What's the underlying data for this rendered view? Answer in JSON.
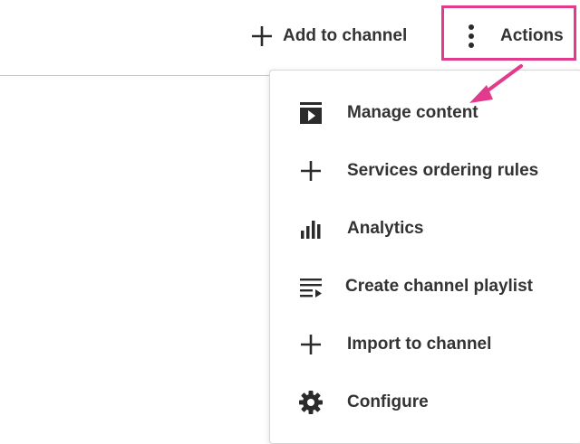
{
  "toolbar": {
    "add_label": "Add to channel",
    "actions_label": "Actions"
  },
  "menu": {
    "items": [
      {
        "label": "Manage content",
        "icon": "play-box-icon"
      },
      {
        "label": "Services ordering rules",
        "icon": "plus-icon"
      },
      {
        "label": "Analytics",
        "icon": "bar-chart-icon"
      },
      {
        "label": "Create channel playlist",
        "icon": "playlist-add-icon"
      },
      {
        "label": "Import to channel",
        "icon": "plus-icon"
      },
      {
        "label": "Configure",
        "icon": "gear-icon"
      }
    ]
  },
  "colors": {
    "highlight": "#e23b8d",
    "text": "#333333",
    "icon": "#2b2b2b"
  }
}
